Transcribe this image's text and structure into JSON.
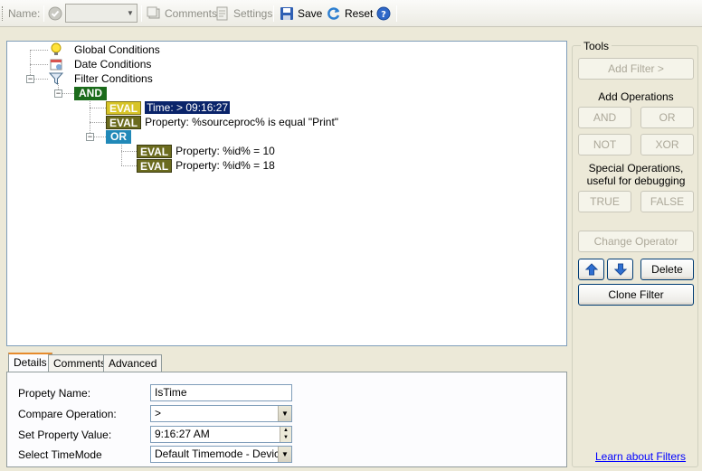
{
  "toolbar": {
    "name_label": "Name:",
    "comments_label": "Comments",
    "settings_label": "Settings",
    "save_label": "Save",
    "reset_label": "Reset"
  },
  "tree": {
    "global_conditions": "Global Conditions",
    "date_conditions": "Date Conditions",
    "filter_conditions": "Filter Conditions",
    "and_label": "AND",
    "or_label": "OR",
    "eval_label": "EVAL",
    "item_time": "Time:  > 09:16:27",
    "item_sourceproc": "Property: %sourceproc% is equal \"Print\"",
    "item_id10": "Property: %id% = 10",
    "item_id18": "Property: %id% = 18"
  },
  "tabs": [
    "Details",
    "Comments",
    "Advanced"
  ],
  "details": {
    "property_name_label": "Propety Name:",
    "property_name_value": "IsTime",
    "compare_op_label": "Compare Operation:",
    "compare_op_value": ">",
    "set_value_label": "Set Property Value:",
    "set_value_value": "9:16:27 AM",
    "timemode_label": "Select TimeMode",
    "timemode_value": "Default Timemode - Devicere"
  },
  "tools": {
    "title": "Tools",
    "add_filter": "Add Filter >",
    "add_operations": "Add Operations",
    "and": "AND",
    "or": "OR",
    "not": "NOT",
    "xor": "XOR",
    "special_ops": "Special Operations,\nuseful for debugging",
    "true": "TRUE",
    "false": "FALSE",
    "change_operator": "Change Operator",
    "delete": "Delete",
    "clone_filter": "Clone Filter",
    "learn_link": "Learn about Filters"
  }
}
